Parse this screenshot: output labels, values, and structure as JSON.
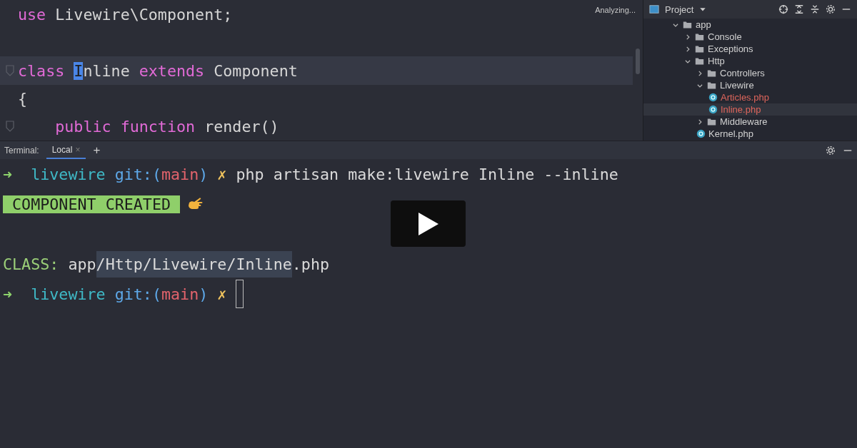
{
  "editor": {
    "status": "Analyzing...",
    "lines": [
      {
        "current": false,
        "fold": false,
        "tokens": [
          {
            "kind": "keyword",
            "text": "use"
          },
          {
            "kind": "plain",
            "text": " Livewire\\Component;"
          }
        ]
      },
      {
        "current": false,
        "fold": false
      },
      {
        "current": true,
        "fold": true,
        "tokens": [
          {
            "kind": "keyword",
            "text": "class "
          },
          {
            "kind": "caret",
            "text": "I"
          },
          {
            "kind": "usage",
            "text": "nline"
          },
          {
            "kind": "keyword",
            "text": " extends"
          },
          {
            "kind": "plain",
            "text": " Component"
          }
        ]
      },
      {
        "current": false,
        "fold": false,
        "tokens": [
          {
            "kind": "plain",
            "text": "{"
          }
        ]
      },
      {
        "current": false,
        "fold": true,
        "tokens": [
          {
            "kind": "keyword",
            "text": "    public"
          },
          {
            "kind": "keyword",
            "text": " function"
          },
          {
            "kind": "plain",
            "text": " render()"
          }
        ]
      }
    ]
  },
  "project": {
    "title": "Project",
    "tree": [
      {
        "label": "app",
        "kind": "folder",
        "expanded": true,
        "selected": false,
        "children": [
          {
            "label": "Console",
            "kind": "folder",
            "expanded": false,
            "selected": false
          },
          {
            "label": "Exceptions",
            "kind": "folder",
            "expanded": false,
            "selected": false
          },
          {
            "label": "Http",
            "kind": "folder",
            "expanded": true,
            "selected": false,
            "children": [
              {
                "label": "Controllers",
                "kind": "folder",
                "expanded": false,
                "selected": false
              },
              {
                "label": "Livewire",
                "kind": "folder",
                "expanded": true,
                "selected": false,
                "children": [
                  {
                    "label": "Articles.php",
                    "kind": "new-class",
                    "selected": false
                  },
                  {
                    "label": "Inline.php",
                    "kind": "new-class",
                    "selected": true
                  }
                ]
              },
              {
                "label": "Middleware",
                "kind": "folder",
                "expanded": false,
                "selected": false
              },
              {
                "label": "Kernel.php",
                "kind": "class",
                "selected": false
              }
            ]
          }
        ]
      }
    ]
  },
  "terminal": {
    "label": "Terminal:",
    "tabs": [
      {
        "label": "Local",
        "selected": true,
        "close": "×"
      }
    ],
    "add": "+",
    "lines": [
      {
        "kind": "prompt",
        "segments": [
          {
            "kind": "arrow",
            "text": "➜  "
          },
          {
            "kind": "dir",
            "text": "livewire "
          },
          {
            "kind": "git",
            "text": "git:("
          },
          {
            "kind": "branch",
            "text": "main"
          },
          {
            "kind": "git",
            "text": ")"
          },
          {
            "kind": "dirty",
            "text": " ✗ "
          },
          {
            "kind": "cmd",
            "text": "php artisan make:livewire Inline --inline"
          }
        ]
      },
      {
        "kind": "result",
        "segments": [
          {
            "kind": "badge",
            "text": " COMPONENT CREATED "
          },
          {
            "kind": "emoji"
          }
        ]
      },
      {
        "kind": "output",
        "segments": [
          {
            "kind": "label",
            "text": "CLASS: "
          },
          {
            "kind": "cmd",
            "text": "app"
          },
          {
            "kind": "selected",
            "text": "/Http/Livewire/Inline"
          },
          {
            "kind": "cmd",
            "text": ".php"
          }
        ]
      },
      {
        "kind": "prompt",
        "segments": [
          {
            "kind": "arrow",
            "text": "➜  "
          },
          {
            "kind": "dir",
            "text": "livewire "
          },
          {
            "kind": "git",
            "text": "git:("
          },
          {
            "kind": "branch",
            "text": "main"
          },
          {
            "kind": "git",
            "text": ")"
          },
          {
            "kind": "dirty",
            "text": " ✗ "
          },
          {
            "kind": "cursor"
          }
        ]
      }
    ]
  },
  "video": {
    "play": true
  }
}
